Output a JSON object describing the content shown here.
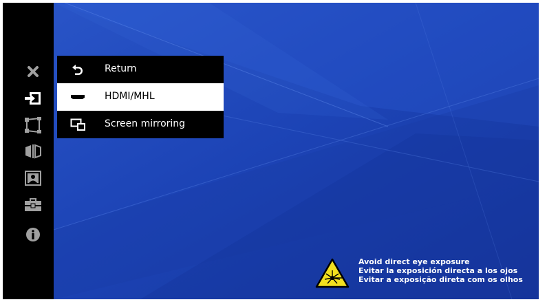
{
  "sidebar": {
    "items": [
      {
        "name": "close",
        "icon": "close-icon",
        "active": false
      },
      {
        "name": "input",
        "icon": "input-source-icon",
        "active": true
      },
      {
        "name": "keystone",
        "icon": "keystone-icon",
        "active": false
      },
      {
        "name": "flip",
        "icon": "flip-icon",
        "active": false
      },
      {
        "name": "picture",
        "icon": "picture-icon",
        "active": false
      },
      {
        "name": "setup",
        "icon": "toolbox-icon",
        "active": false
      },
      {
        "name": "info",
        "icon": "info-icon",
        "active": false
      }
    ]
  },
  "menu": {
    "items": [
      {
        "label": "Return",
        "icon": "return-icon",
        "selected": false
      },
      {
        "label": "HDMI/MHL",
        "icon": "hdmi-icon",
        "selected": true
      },
      {
        "label": "Screen mirroring",
        "icon": "screen-mirroring-icon",
        "selected": false
      }
    ]
  },
  "warning": {
    "icon": "laser-warning-icon",
    "lines": [
      "Avoid direct eye exposure",
      "Evitar la exposición directa a los ojos",
      "Evitar a exposição direta com os olhos"
    ]
  },
  "colors": {
    "background": "#1b3fb0",
    "sidebar": "#000000",
    "menu": "#000000",
    "selected": "#ffffff",
    "warning_yellow": "#f2df1f"
  }
}
